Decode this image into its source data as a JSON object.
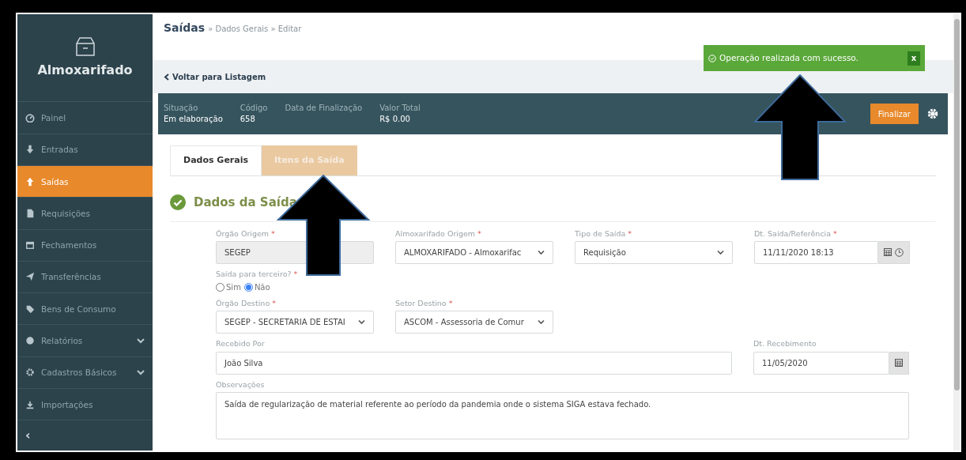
{
  "sidebar": {
    "title": "Almoxarifado",
    "items": [
      {
        "label": "Painel",
        "selected": false,
        "expandable": false
      },
      {
        "label": "Entradas",
        "selected": false,
        "expandable": false
      },
      {
        "label": "Saídas",
        "selected": true,
        "expandable": false
      },
      {
        "label": "Requisições",
        "selected": false,
        "expandable": false
      },
      {
        "label": "Fechamentos",
        "selected": false,
        "expandable": false
      },
      {
        "label": "Transferências",
        "selected": false,
        "expandable": false
      },
      {
        "label": "Bens de Consumo",
        "selected": false,
        "expandable": false
      },
      {
        "label": "Relatórios",
        "selected": false,
        "expandable": true
      },
      {
        "label": "Cadastros Básicos",
        "selected": false,
        "expandable": true
      },
      {
        "label": "Importações",
        "selected": false,
        "expandable": false
      }
    ],
    "collapse": "‹"
  },
  "breadcrumb": {
    "title": "Saídas",
    "trail": "» Dados Gerais » Editar"
  },
  "back_link": "Voltar para Listagem",
  "summary": [
    {
      "label": "Situação",
      "value": "Em elaboração"
    },
    {
      "label": "Código",
      "value": "658"
    },
    {
      "label": "Data de Finalização"
    },
    {
      "label": "Valor Total",
      "value": "R$ 0.00"
    }
  ],
  "finalize_button": "Finalizar",
  "toast": {
    "message": "Operação realizada com sucesso.",
    "close": "x"
  },
  "tabs": [
    {
      "label": "Dados Gerais",
      "selected": true
    },
    {
      "label": "Itens da Saída",
      "selected": false
    }
  ],
  "section_title": "Dados da Saída",
  "form_rows": [
    [
      {
        "kind": "readonly",
        "label": "Órgão Origem",
        "required_mark": "*",
        "value": "SEGEP"
      },
      {
        "kind": "select",
        "label": "Almoxarifado Origem",
        "required_mark": "*",
        "value": "ALMOXARIFADO - Almoxarifac"
      },
      {
        "kind": "select",
        "label": "Tipo de Saída",
        "required_mark": "*",
        "value": "Requisição"
      },
      {
        "kind": "datetime",
        "label": "Dt. Saída/Referência",
        "required_mark": "*",
        "value": "11/11/2020 18:13"
      }
    ],
    [
      {
        "kind": "radio",
        "label": "Saída para terceiro?",
        "required_mark": "*",
        "options": [
          {
            "label": "Sim",
            "selected": false
          },
          {
            "label": "Não",
            "selected": true
          }
        ]
      }
    ],
    [
      {
        "kind": "select",
        "label": "Órgão Destino",
        "required_mark": "*",
        "value": "SEGEP - SECRETARIA DE ESTAI"
      },
      {
        "kind": "select",
        "label": "Setor Destino",
        "required_mark": "*",
        "value": "ASCOM - Assessoria de Comur"
      }
    ],
    [
      {
        "kind": "text",
        "label": "Recebido Por",
        "value": "João Silva"
      },
      {
        "kind": "date",
        "label": "Dt. Recebimento",
        "value": "11/05/2020"
      }
    ],
    [
      {
        "kind": "textarea",
        "label": "Observações",
        "value": "Saída de regularização de material referente ao período da pandemia onde o sistema SIGA estava fechado."
      }
    ]
  ]
}
